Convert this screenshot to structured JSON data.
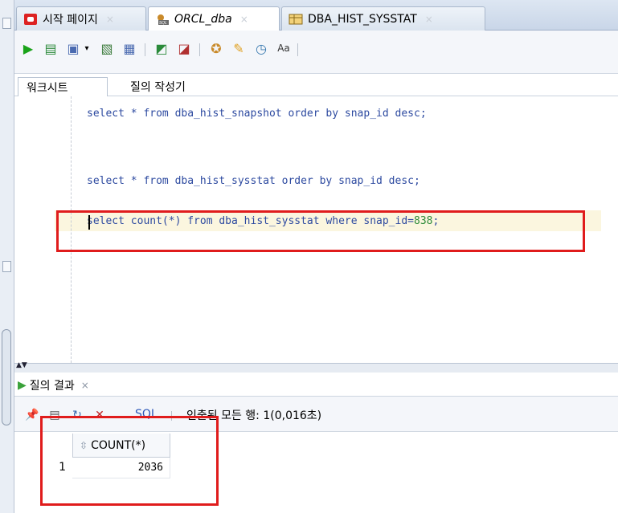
{
  "tabs": [
    {
      "label": "시작 페이지",
      "icon": "oracle-home-icon",
      "active": false
    },
    {
      "label": "ORCL_dba",
      "icon": "sql-connection-icon",
      "active": true
    },
    {
      "label": "DBA_HIST_SYSSTAT",
      "icon": "table-icon",
      "active": false
    }
  ],
  "tab_close": "×",
  "subtabs": {
    "worksheet": "워크시트",
    "query_builder": "질의 작성기"
  },
  "editor": {
    "line1": "select * from dba_hist_snapshot order by snap_id desc;",
    "line2": "select * from dba_hist_sysstat order by snap_id desc;",
    "line3_pre": "select count(*) from dba_hist_sysstat where snap_id=",
    "line3_num": "838",
    "line3_end": ";"
  },
  "results": {
    "tab_label": "질의 결과",
    "close": "×",
    "sql_label": "SQL",
    "status": "인출된 모든 행: 1(0,016초)",
    "column_header": "COUNT(*)",
    "rows": [
      {
        "num": "1",
        "value": "2036"
      }
    ]
  },
  "colors": {
    "annotation": "#e01c1c",
    "keyword": "#2d4aa0",
    "number": "#2e8b3a"
  }
}
